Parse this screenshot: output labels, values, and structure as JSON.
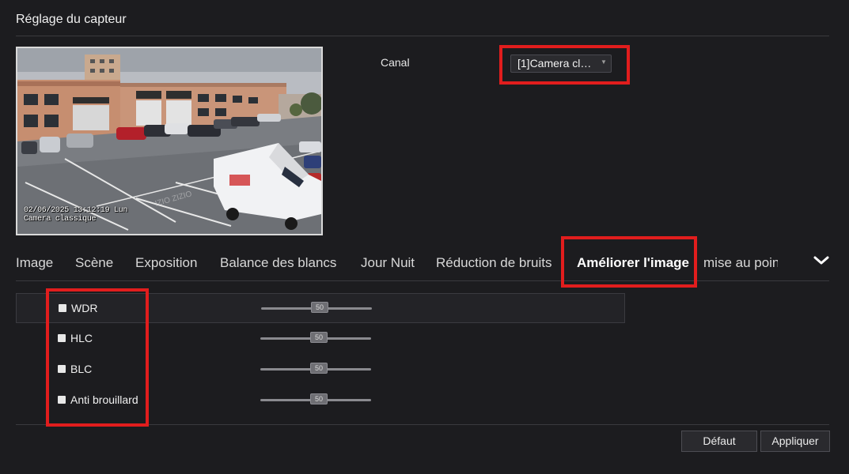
{
  "page": {
    "title": "Réglage du capteur"
  },
  "preview": {
    "osd_datetime": "02/06/2025 13:12:19 Lun",
    "osd_camera_name": "Camera classique"
  },
  "channel": {
    "label": "Canal",
    "selected": "[1]Camera cla..."
  },
  "tabs": [
    {
      "label": "Image",
      "active": false
    },
    {
      "label": "Scène",
      "active": false
    },
    {
      "label": "Exposition",
      "active": false
    },
    {
      "label": "Balance des blancs",
      "active": false
    },
    {
      "label": "Jour Nuit",
      "active": false
    },
    {
      "label": "Réduction de bruits",
      "active": false
    },
    {
      "label": "Améliorer l'image",
      "active": true
    },
    {
      "label": "mise au point",
      "active": false
    }
  ],
  "enhance_settings": [
    {
      "label": "WDR",
      "checked": false,
      "value": "50"
    },
    {
      "label": "HLC",
      "checked": false,
      "value": "50"
    },
    {
      "label": "BLC",
      "checked": false,
      "value": "50"
    },
    {
      "label": "Anti brouillard",
      "checked": false,
      "value": "50"
    }
  ],
  "buttons": {
    "default_label": "Défaut",
    "apply_label": "Appliquer"
  },
  "icons": {
    "tabs_more": "chevron-down-icon",
    "select_caret": "caret-down-icon"
  },
  "colors": {
    "background": "#1c1c1f",
    "highlight_box": "#e11d1d",
    "text": "#e6e6e6"
  }
}
